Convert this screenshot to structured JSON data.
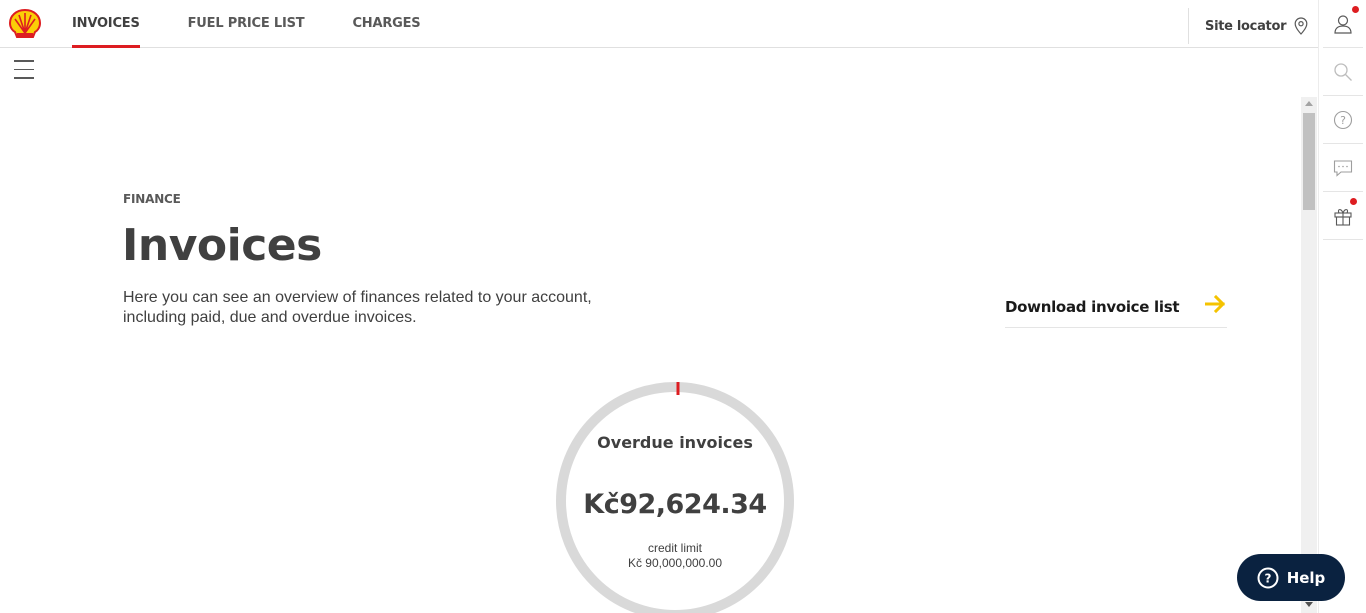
{
  "header": {
    "logo": "shell-pecten-logo",
    "nav": [
      {
        "label": "INVOICES",
        "active": true
      },
      {
        "label": "FUEL PRICE LIST",
        "active": false
      },
      {
        "label": "CHARGES",
        "active": false
      }
    ],
    "site_locator": "Site locator",
    "accent_color": "#dd1d21"
  },
  "rail": {
    "icons": [
      "user-icon",
      "search-icon",
      "help-circle-icon",
      "chat-icon",
      "gift-icon"
    ],
    "notification_color": "#dd1d21"
  },
  "page": {
    "eyebrow": "FINANCE",
    "title": "Invoices",
    "intro": "Here you can see an overview of finances related to your account, including paid, due and overdue invoices.",
    "download_label": "Download invoice list",
    "download_arrow_color": "#f5c300"
  },
  "gauge": {
    "label": "Overdue invoices",
    "value": "Kč92,624.34",
    "sub_label": "credit limit",
    "sub_value": "Kč 90,000,000.00",
    "ring_color": "#d9d9d9",
    "marker_color": "#dd1d21"
  },
  "help": {
    "label": "Help",
    "bg_color": "#0a2240"
  }
}
